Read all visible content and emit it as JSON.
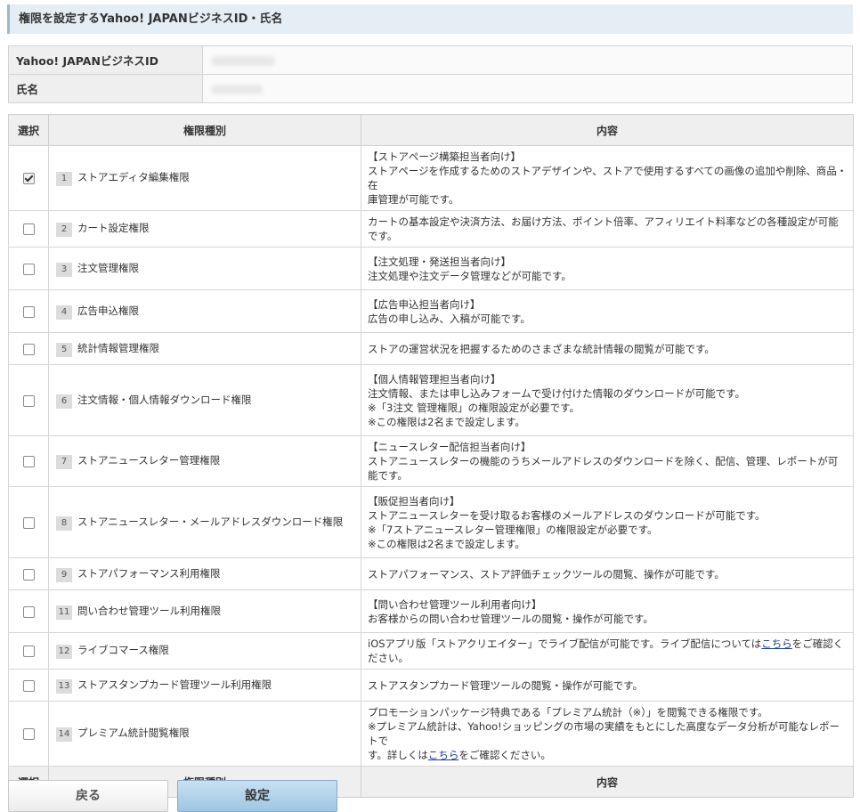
{
  "section_title": "権限を設定するYahoo! JAPANビジネスID・氏名",
  "id_table": {
    "business_id_label": "Yahoo! JAPANビジネスID",
    "name_label": "氏名"
  },
  "perm_table": {
    "headers": {
      "select": "選択",
      "kind": "権限種別",
      "content": "内容"
    },
    "rows": [
      {
        "num": "1",
        "label": "ストアエディタ編集権限",
        "checked": true,
        "desc": [
          "【ストアページ構築担当者向け】",
          "ストアページを作成するためのストアデザインや、ストアで使用するすべての画像の追加や削除、商品・在",
          "庫管理が可能です。"
        ]
      },
      {
        "num": "2",
        "label": "カート設定権限",
        "checked": false,
        "desc": [
          "カートの基本設定や決済方法、お届け方法、ポイント倍率、アフィリエイト料率などの各種設定が可能です。"
        ]
      },
      {
        "num": "3",
        "label": "注文管理権限",
        "checked": false,
        "desc": [
          "【注文処理・発送担当者向け】",
          "注文処理や注文データ管理などが可能です。"
        ]
      },
      {
        "num": "4",
        "label": "広告申込権限",
        "checked": false,
        "desc": [
          "【広告申込担当者向け】",
          "広告の申し込み、入稿が可能です。"
        ]
      },
      {
        "num": "5",
        "label": "統計情報管理権限",
        "checked": false,
        "desc": [
          "ストアの運営状況を把握するためのさまざまな統計情報の閲覧が可能です。"
        ]
      },
      {
        "num": "6",
        "label": "注文情報・個人情報ダウンロード権限",
        "checked": false,
        "desc": [
          "【個人情報管理担当者向け】",
          "注文情報、または申し込みフォームで受け付けた情報のダウンロードが可能です。",
          "※「3注文 管理権限」の権限設定が必要です。",
          "※この権限は2名まで設定します。"
        ]
      },
      {
        "num": "7",
        "label": "ストアニュースレター管理権限",
        "checked": false,
        "desc": [
          "【ニュースレター配信担当者向け】",
          "ストアニュースレターの機能のうちメールアドレスのダウンロードを除く、配信、管理、レポートが可能です。"
        ]
      },
      {
        "num": "8",
        "label": "ストアニュースレター・メールアドレスダウンロード権限",
        "checked": false,
        "desc": [
          "【販促担当者向け】",
          "ストアニュースレターを受け取るお客様のメールアドレスのダウンロードが可能です。",
          "※「7ストアニュースレター管理権限」の権限設定が必要です。",
          "※この権限は2名まで設定します。"
        ]
      },
      {
        "num": "9",
        "label": "ストアパフォーマンス利用権限",
        "checked": false,
        "desc": [
          "ストアパフォーマンス、ストア評価チェックツールの閲覧、操作が可能です。"
        ]
      },
      {
        "num": "11",
        "label": "問い合わせ管理ツール利用権限",
        "checked": false,
        "desc": [
          "【問い合わせ管理ツール利用者向け】",
          "お客様からの問い合わせ管理ツールの閲覧・操作が可能です。"
        ]
      },
      {
        "num": "12",
        "label": "ライブコマース権限",
        "checked": false,
        "desc_live": {
          "before": "iOSアプリ版「ストアクリエイター」でライブ配信が可能です。ライブ配信については",
          "link": "こちら",
          "after": "をご確認ください。"
        }
      },
      {
        "num": "13",
        "label": "ストアスタンプカード管理ツール利用権限",
        "checked": false,
        "desc": [
          "ストアスタンプカード管理ツールの閲覧・操作が可能です。"
        ]
      },
      {
        "num": "14",
        "label": "プレミアム統計閲覧権限",
        "checked": false,
        "desc_premium": {
          "line1": "プロモーションパッケージ特典である「プレミアム統計（※）」を閲覧できる権限です。",
          "line2": "※プレミアム統計は、Yahoo!ショッピングの市場の実績をもとにした高度なデータ分析が可能なレポートで",
          "line3_before": "す。詳しくは",
          "link": "こちら",
          "line3_after": "をご確認ください。"
        }
      }
    ]
  },
  "buttons": {
    "back": "戻る",
    "submit": "設定"
  }
}
